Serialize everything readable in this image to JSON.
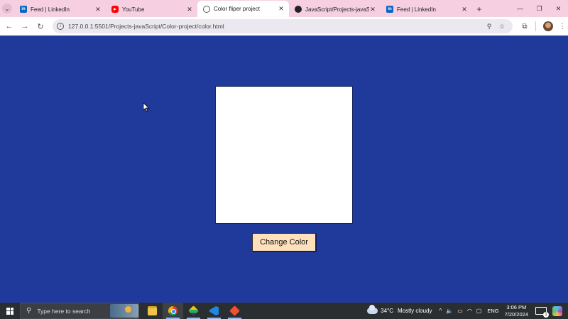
{
  "browser": {
    "tabs": [
      {
        "title": "Feed | LinkedIn",
        "icon": "linkedin-icon",
        "active": false
      },
      {
        "title": "YouTube",
        "icon": "youtube-icon",
        "active": false
      },
      {
        "title": "Color fliper project",
        "icon": "globe-icon",
        "active": true
      },
      {
        "title": "JavaScript/Projects-javaScri...",
        "icon": "github-icon",
        "active": false
      },
      {
        "title": "Feed | LinkedIn",
        "icon": "linkedin-icon",
        "active": false
      }
    ],
    "close_glyph": "✕",
    "new_tab_glyph": "+",
    "window_controls": {
      "minimize": "—",
      "restore": "❐",
      "close": "✕"
    },
    "address": {
      "url": "127.0.0.1:5501/Projects-javaScript/Color-project/color.html"
    },
    "nav": {
      "back": "←",
      "forward": "→",
      "reload": "↻"
    }
  },
  "page": {
    "background_color": "#1f3a9a",
    "box_color": "#ffffff",
    "button_label": "Change Color",
    "button_color": "#ffe0bd"
  },
  "taskbar": {
    "search_placeholder": "Type here to search",
    "apps": [
      "file-explorer-icon",
      "chrome-icon",
      "layers-app-icon",
      "vscode-icon",
      "git-icon"
    ],
    "weather": {
      "temp": "34°C",
      "condition": "Mostly cloudy"
    },
    "language": "ENG",
    "time": "3:06 PM",
    "date": "7/20/2024",
    "notification_count": "1"
  }
}
